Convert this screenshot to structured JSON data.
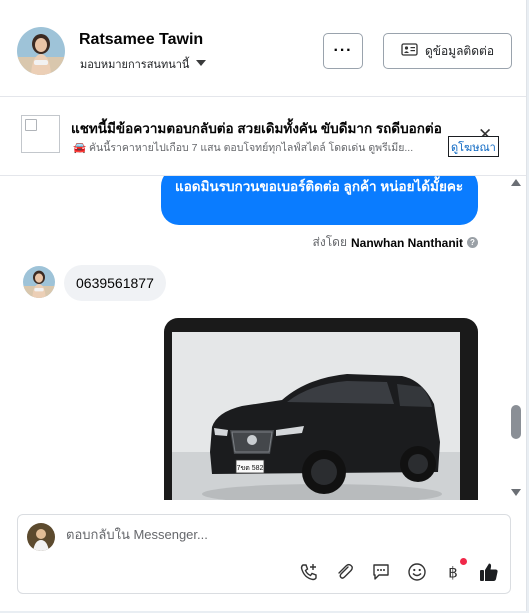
{
  "header": {
    "contact_name": "Ratsamee Tawin",
    "assign_label": "มอบหมายการสนทนานี้",
    "more_label": "···",
    "contact_info_label": "ดูข้อมูลติดต่อ"
  },
  "ad": {
    "title": "แชทนี้มีข้อความตอบกลับต่อ สวยเดิมทั้งคัน ขับดีมาก รถดีบอกต่อ",
    "subtitle": "🚘 คันนี้ราคาหายไปเกือบ 7 แสน ตอบโจทย์ทุกไลฟ์สไตล์ โดดเด่น ดูพรีเมีย...",
    "close_label": "✕",
    "view_ad_label": "ดูโฆษณา"
  },
  "thread": {
    "outgoing_text": "แอดมินรบกวนขอเบอร์ติดต่อ ลูกค้า  หน่อยได้มั้ยคะ",
    "sent_by_prefix": "ส่งโดย",
    "sent_by_name": "Nanwhan Nanthanit",
    "incoming_text": "0639561877",
    "car_plate": "7ขต 582"
  },
  "composer": {
    "placeholder": "ตอบกลับใน Messenger..."
  },
  "colors": {
    "messenger_blue": "#0a7cff",
    "incoming_bubble": "#f0f2f5",
    "link_blue": "#0a66c2",
    "notification_red": "#f02849"
  },
  "icons": [
    "chevron-down-icon",
    "contact-card-icon",
    "close-icon",
    "help-icon",
    "add-call-icon",
    "attachment-icon",
    "saved-replies-icon",
    "emoji-icon",
    "baht-payment-icon",
    "like-icon",
    "scroll-up-icon",
    "scroll-down-icon"
  ]
}
